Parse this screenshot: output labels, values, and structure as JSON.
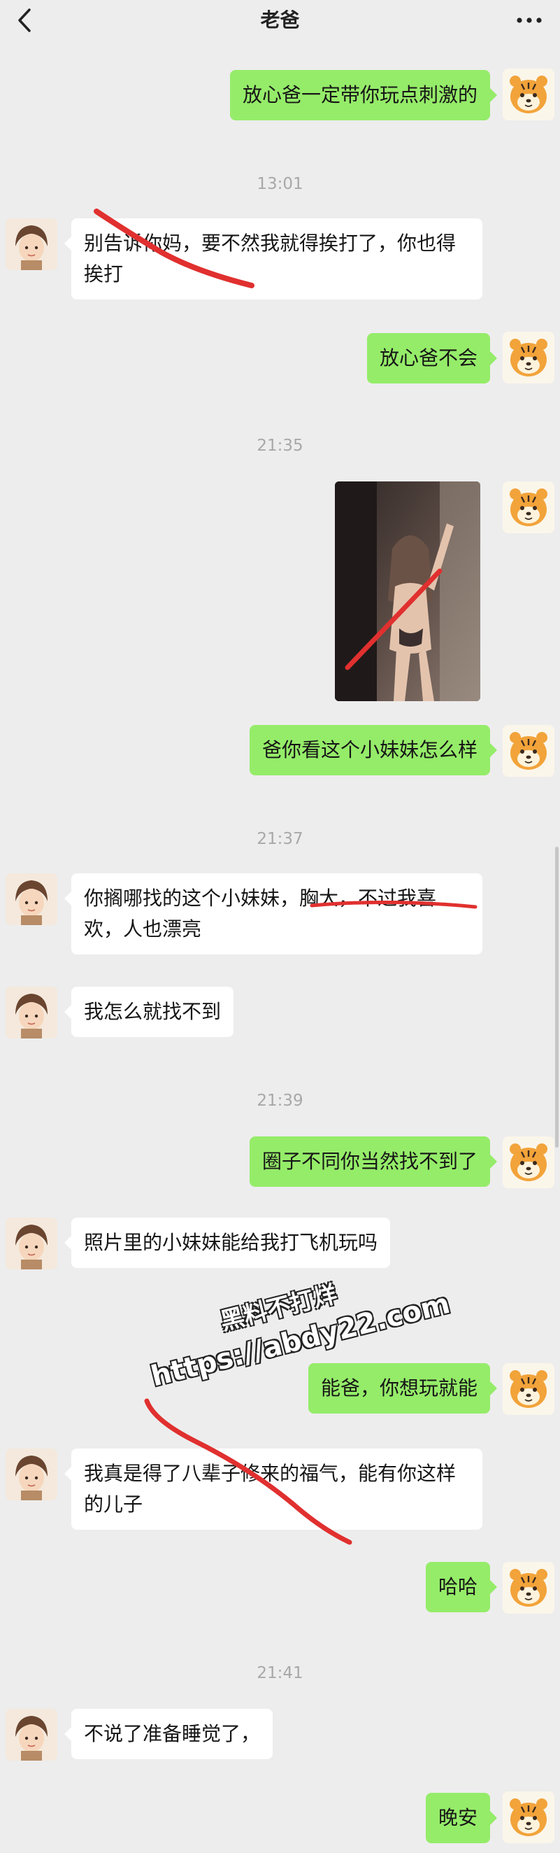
{
  "header": {
    "title": "老爸"
  },
  "timestamps": [
    "13:01",
    "21:35",
    "21:37",
    "21:39",
    "21:41"
  ],
  "messages": [
    {
      "from": "me",
      "text": "放心爸一定带你玩点刺激的"
    },
    {
      "from": "dad",
      "text": "别告诉你妈，要不然我就得挨打了，你也得挨打"
    },
    {
      "from": "me",
      "text": "放心爸不会"
    },
    {
      "from": "me",
      "text": "爸你看这个小妹妹怎么样"
    },
    {
      "from": "dad",
      "text": "你搁哪找的这个小妹妹，胸大，不过我喜欢，人也漂亮"
    },
    {
      "from": "dad",
      "text": "我怎么就找不到"
    },
    {
      "from": "me",
      "text": "圈子不同你当然找不到了"
    },
    {
      "from": "dad",
      "text": "照片里的小妹妹能给我打飞机玩吗"
    },
    {
      "from": "me",
      "text": "能爸，你想玩就能"
    },
    {
      "from": "dad",
      "text": "我真是得了八辈子修来的福气，能有你这样的儿子"
    },
    {
      "from": "me",
      "text": "哈哈"
    },
    {
      "from": "dad",
      "text": "不说了准备睡觉了，"
    },
    {
      "from": "me",
      "text": "晚安"
    }
  ],
  "watermark": {
    "line1": "黑料不打烊",
    "line2": "https://abdy22.com"
  },
  "colors": {
    "background": "#ededed",
    "outgoing_bubble": "#95ec69",
    "incoming_bubble": "#ffffff",
    "scribble": "#e0302f"
  }
}
